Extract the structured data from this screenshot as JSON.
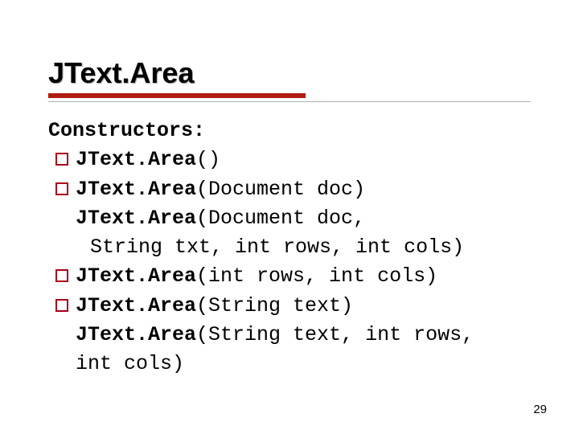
{
  "title": "JText.Area",
  "heading": "Constructors:",
  "items": [
    {
      "name": "JText.Area",
      "sig": "()"
    },
    {
      "name": "JText.Area",
      "sig": "(Document doc)"
    },
    {
      "name": "JText.Area",
      "sig": "(Document doc,"
    },
    {
      "cont": "String txt, int rows, int cols)"
    },
    {
      "name": "JText.Area",
      "sig": "(int rows, int cols)"
    },
    {
      "name": "JText.Area",
      "sig": "(String text)"
    },
    {
      "name": "JText.Area",
      "sig": "(String text, int rows,"
    },
    {
      "cont2": "int cols)"
    }
  ],
  "page": "29"
}
